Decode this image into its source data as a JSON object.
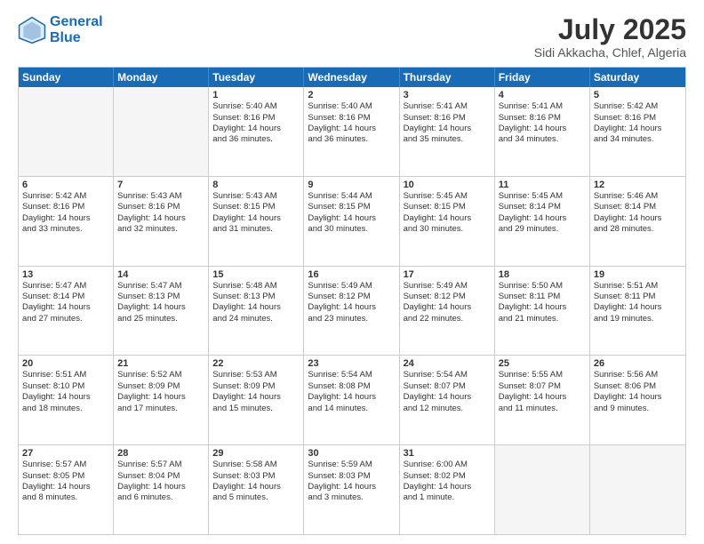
{
  "logo": {
    "line1": "General",
    "line2": "Blue"
  },
  "title": "July 2025",
  "location": "Sidi Akkacha, Chlef, Algeria",
  "weekdays": [
    "Sunday",
    "Monday",
    "Tuesday",
    "Wednesday",
    "Thursday",
    "Friday",
    "Saturday"
  ],
  "rows": [
    [
      {
        "day": "",
        "empty": true,
        "lines": []
      },
      {
        "day": "",
        "empty": true,
        "lines": []
      },
      {
        "day": "1",
        "lines": [
          "Sunrise: 5:40 AM",
          "Sunset: 8:16 PM",
          "Daylight: 14 hours",
          "and 36 minutes."
        ]
      },
      {
        "day": "2",
        "lines": [
          "Sunrise: 5:40 AM",
          "Sunset: 8:16 PM",
          "Daylight: 14 hours",
          "and 36 minutes."
        ]
      },
      {
        "day": "3",
        "lines": [
          "Sunrise: 5:41 AM",
          "Sunset: 8:16 PM",
          "Daylight: 14 hours",
          "and 35 minutes."
        ]
      },
      {
        "day": "4",
        "lines": [
          "Sunrise: 5:41 AM",
          "Sunset: 8:16 PM",
          "Daylight: 14 hours",
          "and 34 minutes."
        ]
      },
      {
        "day": "5",
        "lines": [
          "Sunrise: 5:42 AM",
          "Sunset: 8:16 PM",
          "Daylight: 14 hours",
          "and 34 minutes."
        ]
      }
    ],
    [
      {
        "day": "6",
        "lines": [
          "Sunrise: 5:42 AM",
          "Sunset: 8:16 PM",
          "Daylight: 14 hours",
          "and 33 minutes."
        ]
      },
      {
        "day": "7",
        "lines": [
          "Sunrise: 5:43 AM",
          "Sunset: 8:16 PM",
          "Daylight: 14 hours",
          "and 32 minutes."
        ]
      },
      {
        "day": "8",
        "lines": [
          "Sunrise: 5:43 AM",
          "Sunset: 8:15 PM",
          "Daylight: 14 hours",
          "and 31 minutes."
        ]
      },
      {
        "day": "9",
        "lines": [
          "Sunrise: 5:44 AM",
          "Sunset: 8:15 PM",
          "Daylight: 14 hours",
          "and 30 minutes."
        ]
      },
      {
        "day": "10",
        "lines": [
          "Sunrise: 5:45 AM",
          "Sunset: 8:15 PM",
          "Daylight: 14 hours",
          "and 30 minutes."
        ]
      },
      {
        "day": "11",
        "lines": [
          "Sunrise: 5:45 AM",
          "Sunset: 8:14 PM",
          "Daylight: 14 hours",
          "and 29 minutes."
        ]
      },
      {
        "day": "12",
        "lines": [
          "Sunrise: 5:46 AM",
          "Sunset: 8:14 PM",
          "Daylight: 14 hours",
          "and 28 minutes."
        ]
      }
    ],
    [
      {
        "day": "13",
        "lines": [
          "Sunrise: 5:47 AM",
          "Sunset: 8:14 PM",
          "Daylight: 14 hours",
          "and 27 minutes."
        ]
      },
      {
        "day": "14",
        "lines": [
          "Sunrise: 5:47 AM",
          "Sunset: 8:13 PM",
          "Daylight: 14 hours",
          "and 25 minutes."
        ]
      },
      {
        "day": "15",
        "lines": [
          "Sunrise: 5:48 AM",
          "Sunset: 8:13 PM",
          "Daylight: 14 hours",
          "and 24 minutes."
        ]
      },
      {
        "day": "16",
        "lines": [
          "Sunrise: 5:49 AM",
          "Sunset: 8:12 PM",
          "Daylight: 14 hours",
          "and 23 minutes."
        ]
      },
      {
        "day": "17",
        "lines": [
          "Sunrise: 5:49 AM",
          "Sunset: 8:12 PM",
          "Daylight: 14 hours",
          "and 22 minutes."
        ]
      },
      {
        "day": "18",
        "lines": [
          "Sunrise: 5:50 AM",
          "Sunset: 8:11 PM",
          "Daylight: 14 hours",
          "and 21 minutes."
        ]
      },
      {
        "day": "19",
        "lines": [
          "Sunrise: 5:51 AM",
          "Sunset: 8:11 PM",
          "Daylight: 14 hours",
          "and 19 minutes."
        ]
      }
    ],
    [
      {
        "day": "20",
        "lines": [
          "Sunrise: 5:51 AM",
          "Sunset: 8:10 PM",
          "Daylight: 14 hours",
          "and 18 minutes."
        ]
      },
      {
        "day": "21",
        "lines": [
          "Sunrise: 5:52 AM",
          "Sunset: 8:09 PM",
          "Daylight: 14 hours",
          "and 17 minutes."
        ]
      },
      {
        "day": "22",
        "lines": [
          "Sunrise: 5:53 AM",
          "Sunset: 8:09 PM",
          "Daylight: 14 hours",
          "and 15 minutes."
        ]
      },
      {
        "day": "23",
        "lines": [
          "Sunrise: 5:54 AM",
          "Sunset: 8:08 PM",
          "Daylight: 14 hours",
          "and 14 minutes."
        ]
      },
      {
        "day": "24",
        "lines": [
          "Sunrise: 5:54 AM",
          "Sunset: 8:07 PM",
          "Daylight: 14 hours",
          "and 12 minutes."
        ]
      },
      {
        "day": "25",
        "lines": [
          "Sunrise: 5:55 AM",
          "Sunset: 8:07 PM",
          "Daylight: 14 hours",
          "and 11 minutes."
        ]
      },
      {
        "day": "26",
        "lines": [
          "Sunrise: 5:56 AM",
          "Sunset: 8:06 PM",
          "Daylight: 14 hours",
          "and 9 minutes."
        ]
      }
    ],
    [
      {
        "day": "27",
        "lines": [
          "Sunrise: 5:57 AM",
          "Sunset: 8:05 PM",
          "Daylight: 14 hours",
          "and 8 minutes."
        ]
      },
      {
        "day": "28",
        "lines": [
          "Sunrise: 5:57 AM",
          "Sunset: 8:04 PM",
          "Daylight: 14 hours",
          "and 6 minutes."
        ]
      },
      {
        "day": "29",
        "lines": [
          "Sunrise: 5:58 AM",
          "Sunset: 8:03 PM",
          "Daylight: 14 hours",
          "and 5 minutes."
        ]
      },
      {
        "day": "30",
        "lines": [
          "Sunrise: 5:59 AM",
          "Sunset: 8:03 PM",
          "Daylight: 14 hours",
          "and 3 minutes."
        ]
      },
      {
        "day": "31",
        "lines": [
          "Sunrise: 6:00 AM",
          "Sunset: 8:02 PM",
          "Daylight: 14 hours",
          "and 1 minute."
        ]
      },
      {
        "day": "",
        "empty": true,
        "lines": []
      },
      {
        "day": "",
        "empty": true,
        "lines": []
      }
    ]
  ]
}
